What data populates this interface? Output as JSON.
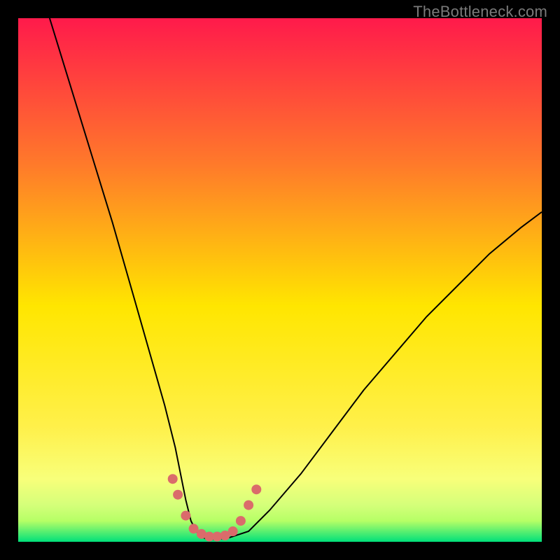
{
  "watermark": "TheBottleneck.com",
  "chart_data": {
    "type": "line",
    "title": "",
    "xlabel": "",
    "ylabel": "",
    "xlim": [
      0,
      100
    ],
    "ylim": [
      0,
      100
    ],
    "background_gradient": {
      "top": "#ff1a4b",
      "mid_upper": "#ff7a2a",
      "mid": "#ffe600",
      "lower_band": "#f8ff7a",
      "green_top": "#b6ff66",
      "green_bottom": "#00e07a"
    },
    "series": [
      {
        "name": "curve",
        "color": "#000000",
        "stroke_width": 2,
        "x": [
          6,
          10,
          14,
          18,
          22,
          26,
          28,
          30,
          31,
          32,
          33,
          34,
          35,
          36,
          38,
          40,
          44,
          48,
          54,
          60,
          66,
          72,
          78,
          84,
          90,
          96,
          100
        ],
        "y": [
          100,
          87,
          74,
          61,
          47,
          33,
          26,
          18,
          13,
          8,
          4,
          2,
          1,
          0.5,
          0.5,
          0.7,
          2,
          6,
          13,
          21,
          29,
          36,
          43,
          49,
          55,
          60,
          63
        ]
      },
      {
        "name": "dotted-markers",
        "color": "#da6b6b",
        "marker_radius": 7,
        "x": [
          29.5,
          30.5,
          32,
          33.5,
          35,
          36.5,
          38,
          39.5,
          41,
          42.5,
          44,
          45.5
        ],
        "y": [
          12,
          9,
          5,
          2.5,
          1.5,
          1,
          1,
          1.2,
          2,
          4,
          7,
          10
        ]
      }
    ]
  }
}
